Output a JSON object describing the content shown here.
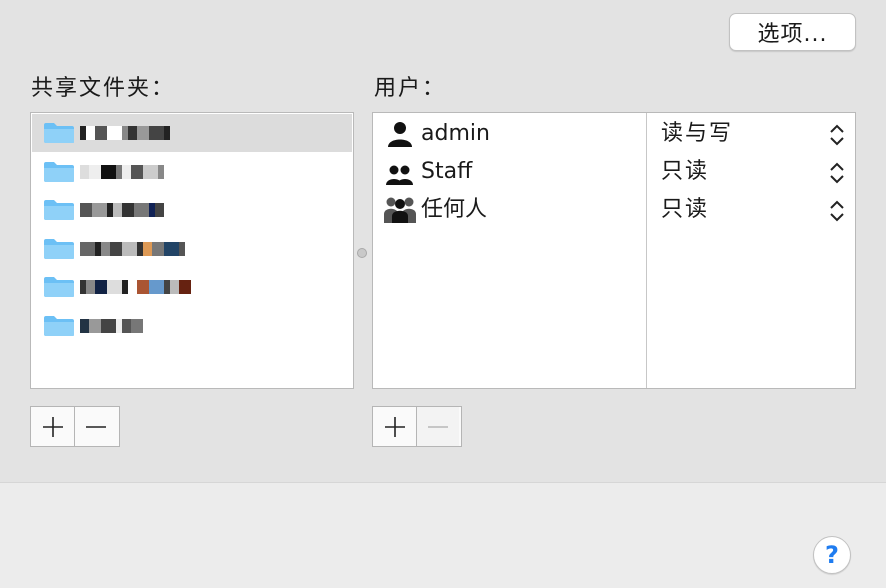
{
  "toolbar": {
    "options_label": "选项..."
  },
  "shared_folders": {
    "label": "共享文件夹：",
    "selected_index": 0,
    "items": [
      {
        "icon": "folder-icon",
        "name_obscured": true
      },
      {
        "icon": "folder-icon",
        "name_obscured": true
      },
      {
        "icon": "folder-icon",
        "name_obscured": true
      },
      {
        "icon": "folder-icon",
        "name_obscured": true
      },
      {
        "icon": "folder-icon",
        "name_obscured": true
      },
      {
        "icon": "folder-icon",
        "name_obscured": true
      }
    ],
    "add_label": "+",
    "remove_label": "−"
  },
  "users": {
    "label": "用户：",
    "items": [
      {
        "name": "admin",
        "icon": "single-user-icon",
        "permission": "读与写"
      },
      {
        "name": "Staff",
        "icon": "group-icon",
        "permission": "只读"
      },
      {
        "name": "任何人",
        "icon": "everyone-icon",
        "permission": "只读"
      }
    ],
    "add_label": "+",
    "remove_label": "−"
  },
  "help_label": "?",
  "colors": {
    "folder_blue": "#6cc0f5",
    "help_blue": "#1f7cf0",
    "panel_bg": "#e3e3e3"
  }
}
